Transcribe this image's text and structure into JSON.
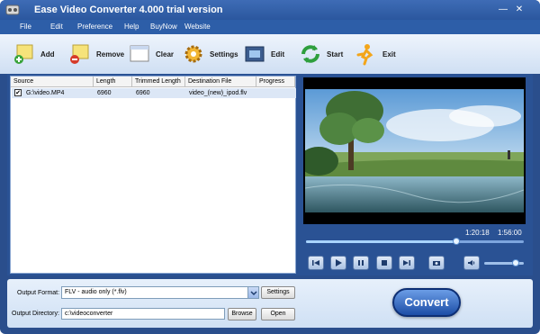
{
  "window": {
    "title": "Ease Video Converter 4.000  trial version"
  },
  "menu": {
    "items": [
      "File",
      "Edit",
      "Preference",
      "Help",
      "BuyNow",
      "Website"
    ]
  },
  "toolbar": {
    "add": "Add",
    "remove": "Remove",
    "clear": "Clear",
    "settings": "Settings",
    "edit": "Edit",
    "start": "Start",
    "exit": "Exit"
  },
  "filelist": {
    "columns": [
      "Source",
      "Length",
      "Trimmed Length",
      "Destination File",
      "Progress"
    ],
    "rows": [
      {
        "checked": true,
        "source": "G:\\video.MP4",
        "length": "6960",
        "trimmed": "6960",
        "destination": "video_(new)_ipod.flv",
        "progress": ""
      }
    ]
  },
  "player": {
    "current_time": "1:20:18",
    "total_time": "1:56:00",
    "seek_fraction": 0.69,
    "volume_fraction": 0.8
  },
  "output": {
    "format_label": "Output Format:",
    "format_value": "FLV - audio only (*.flv)",
    "settings_btn": "Settings",
    "dir_label": "Output Directory:",
    "dir_value": "c:\\videoconverter",
    "browse_btn": "Browse",
    "open_btn": "Open"
  },
  "convert": {
    "label": "Convert"
  }
}
